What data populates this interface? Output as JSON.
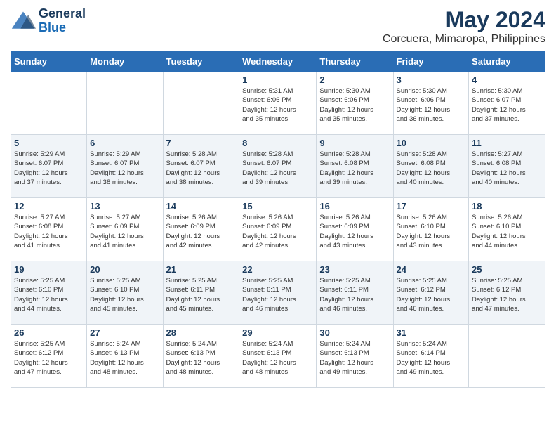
{
  "header": {
    "logo_line1": "General",
    "logo_line2": "Blue",
    "title": "May 2024",
    "subtitle": "Corcuera, Mimaropa, Philippines"
  },
  "days_of_week": [
    "Sunday",
    "Monday",
    "Tuesday",
    "Wednesday",
    "Thursday",
    "Friday",
    "Saturday"
  ],
  "weeks": [
    [
      {
        "num": "",
        "info": ""
      },
      {
        "num": "",
        "info": ""
      },
      {
        "num": "",
        "info": ""
      },
      {
        "num": "1",
        "info": "Sunrise: 5:31 AM\nSunset: 6:06 PM\nDaylight: 12 hours\nand 35 minutes."
      },
      {
        "num": "2",
        "info": "Sunrise: 5:30 AM\nSunset: 6:06 PM\nDaylight: 12 hours\nand 35 minutes."
      },
      {
        "num": "3",
        "info": "Sunrise: 5:30 AM\nSunset: 6:06 PM\nDaylight: 12 hours\nand 36 minutes."
      },
      {
        "num": "4",
        "info": "Sunrise: 5:30 AM\nSunset: 6:07 PM\nDaylight: 12 hours\nand 37 minutes."
      }
    ],
    [
      {
        "num": "5",
        "info": "Sunrise: 5:29 AM\nSunset: 6:07 PM\nDaylight: 12 hours\nand 37 minutes."
      },
      {
        "num": "6",
        "info": "Sunrise: 5:29 AM\nSunset: 6:07 PM\nDaylight: 12 hours\nand 38 minutes."
      },
      {
        "num": "7",
        "info": "Sunrise: 5:28 AM\nSunset: 6:07 PM\nDaylight: 12 hours\nand 38 minutes."
      },
      {
        "num": "8",
        "info": "Sunrise: 5:28 AM\nSunset: 6:07 PM\nDaylight: 12 hours\nand 39 minutes."
      },
      {
        "num": "9",
        "info": "Sunrise: 5:28 AM\nSunset: 6:08 PM\nDaylight: 12 hours\nand 39 minutes."
      },
      {
        "num": "10",
        "info": "Sunrise: 5:28 AM\nSunset: 6:08 PM\nDaylight: 12 hours\nand 40 minutes."
      },
      {
        "num": "11",
        "info": "Sunrise: 5:27 AM\nSunset: 6:08 PM\nDaylight: 12 hours\nand 40 minutes."
      }
    ],
    [
      {
        "num": "12",
        "info": "Sunrise: 5:27 AM\nSunset: 6:08 PM\nDaylight: 12 hours\nand 41 minutes."
      },
      {
        "num": "13",
        "info": "Sunrise: 5:27 AM\nSunset: 6:09 PM\nDaylight: 12 hours\nand 41 minutes."
      },
      {
        "num": "14",
        "info": "Sunrise: 5:26 AM\nSunset: 6:09 PM\nDaylight: 12 hours\nand 42 minutes."
      },
      {
        "num": "15",
        "info": "Sunrise: 5:26 AM\nSunset: 6:09 PM\nDaylight: 12 hours\nand 42 minutes."
      },
      {
        "num": "16",
        "info": "Sunrise: 5:26 AM\nSunset: 6:09 PM\nDaylight: 12 hours\nand 43 minutes."
      },
      {
        "num": "17",
        "info": "Sunrise: 5:26 AM\nSunset: 6:10 PM\nDaylight: 12 hours\nand 43 minutes."
      },
      {
        "num": "18",
        "info": "Sunrise: 5:26 AM\nSunset: 6:10 PM\nDaylight: 12 hours\nand 44 minutes."
      }
    ],
    [
      {
        "num": "19",
        "info": "Sunrise: 5:25 AM\nSunset: 6:10 PM\nDaylight: 12 hours\nand 44 minutes."
      },
      {
        "num": "20",
        "info": "Sunrise: 5:25 AM\nSunset: 6:10 PM\nDaylight: 12 hours\nand 45 minutes."
      },
      {
        "num": "21",
        "info": "Sunrise: 5:25 AM\nSunset: 6:11 PM\nDaylight: 12 hours\nand 45 minutes."
      },
      {
        "num": "22",
        "info": "Sunrise: 5:25 AM\nSunset: 6:11 PM\nDaylight: 12 hours\nand 46 minutes."
      },
      {
        "num": "23",
        "info": "Sunrise: 5:25 AM\nSunset: 6:11 PM\nDaylight: 12 hours\nand 46 minutes."
      },
      {
        "num": "24",
        "info": "Sunrise: 5:25 AM\nSunset: 6:12 PM\nDaylight: 12 hours\nand 46 minutes."
      },
      {
        "num": "25",
        "info": "Sunrise: 5:25 AM\nSunset: 6:12 PM\nDaylight: 12 hours\nand 47 minutes."
      }
    ],
    [
      {
        "num": "26",
        "info": "Sunrise: 5:25 AM\nSunset: 6:12 PM\nDaylight: 12 hours\nand 47 minutes."
      },
      {
        "num": "27",
        "info": "Sunrise: 5:24 AM\nSunset: 6:13 PM\nDaylight: 12 hours\nand 48 minutes."
      },
      {
        "num": "28",
        "info": "Sunrise: 5:24 AM\nSunset: 6:13 PM\nDaylight: 12 hours\nand 48 minutes."
      },
      {
        "num": "29",
        "info": "Sunrise: 5:24 AM\nSunset: 6:13 PM\nDaylight: 12 hours\nand 48 minutes."
      },
      {
        "num": "30",
        "info": "Sunrise: 5:24 AM\nSunset: 6:13 PM\nDaylight: 12 hours\nand 49 minutes."
      },
      {
        "num": "31",
        "info": "Sunrise: 5:24 AM\nSunset: 6:14 PM\nDaylight: 12 hours\nand 49 minutes."
      },
      {
        "num": "",
        "info": ""
      }
    ]
  ]
}
